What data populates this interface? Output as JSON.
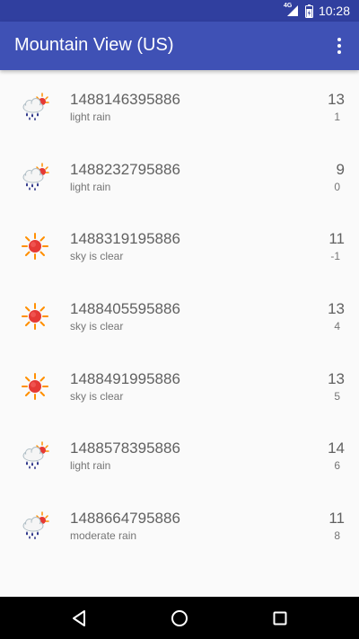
{
  "status_bar": {
    "network": "4G",
    "time": "10:28"
  },
  "app_bar": {
    "title": "Mountain View (US)",
    "menu_icon": "more-vert-icon"
  },
  "forecast": [
    {
      "time": "1488146395886",
      "desc": "light rain",
      "high": "13",
      "low": "1",
      "icon": "rain-icon"
    },
    {
      "time": "1488232795886",
      "desc": "light rain",
      "high": "9",
      "low": "0",
      "icon": "rain-icon"
    },
    {
      "time": "1488319195886",
      "desc": "sky is clear",
      "high": "11",
      "low": "-1",
      "icon": "sun-icon"
    },
    {
      "time": "1488405595886",
      "desc": "sky is clear",
      "high": "13",
      "low": "4",
      "icon": "sun-icon"
    },
    {
      "time": "1488491995886",
      "desc": "sky is clear",
      "high": "13",
      "low": "5",
      "icon": "sun-icon"
    },
    {
      "time": "1488578395886",
      "desc": "light rain",
      "high": "14",
      "low": "6",
      "icon": "rain-icon"
    },
    {
      "time": "1488664795886",
      "desc": "moderate rain",
      "high": "11",
      "low": "8",
      "icon": "rain-icon"
    }
  ],
  "colors": {
    "status_bar": "#303f9f",
    "app_bar": "#3f51b5",
    "background": "#fafafa",
    "sun": "#e53935",
    "cloud": "#eceff1",
    "raindrop": "#1a237e"
  },
  "nav_bar": {
    "back_icon": "back-icon",
    "home_icon": "home-icon",
    "recents_icon": "recents-icon"
  }
}
